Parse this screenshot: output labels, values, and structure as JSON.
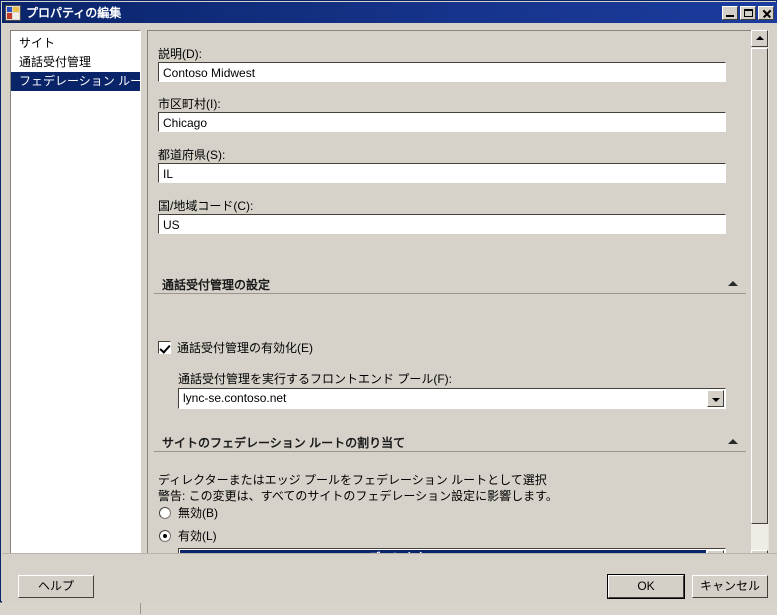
{
  "window": {
    "title": "プロパティの編集",
    "icon": "properties-icon",
    "controls": {
      "minimize": "minimize-button",
      "maximize": "maximize-button",
      "close": "close-button"
    },
    "accent_titlebar": "#0a246a",
    "face_color": "#d6d2ca",
    "selection_color": "#0a246a"
  },
  "sidebar": {
    "items": [
      {
        "label": "サイト",
        "selected": false
      },
      {
        "label": "通話受付管理",
        "selected": false
      },
      {
        "label": "フェデレーション ルート",
        "selected": true
      }
    ]
  },
  "form": {
    "fields": [
      {
        "label": "説明(D):",
        "value": "Contoso Midwest"
      },
      {
        "label": "市区町村(I):",
        "value": "Chicago"
      },
      {
        "label": "都道府県(S):",
        "value": "IL"
      },
      {
        "label": "国/地域コード(C):",
        "value": "US"
      }
    ]
  },
  "section_cac": {
    "header": "通話受付管理の設定",
    "collapse_arrow": "chevron-up-icon",
    "checkbox": {
      "label": "通話受付管理の有効化(E)",
      "checked": true
    },
    "pool_label": "通話受付管理を実行するフロントエンド プール(F):",
    "pool_value": "lync-se.contoso.net"
  },
  "section_federation": {
    "header": "サイトのフェデレーション ルートの割り当て",
    "collapse_arrow": "chevron-up-icon",
    "description_line1": "ディレクターまたはエッジ プールをフェデレーション ルートとして選択",
    "description_line2": "警告: この変更は、すべてのサイトのフェデレーション設定に影響します。",
    "radio_disabled": {
      "label": "無効(B)",
      "selected": false
    },
    "radio_enabled": {
      "label": "有効(L)",
      "selected": true
    },
    "route_value": "lync-dir.contoso.net　Chicago　ディレクター"
  },
  "buttons": {
    "help": "ヘルプ",
    "ok": "OK",
    "cancel": "キャンセル"
  }
}
